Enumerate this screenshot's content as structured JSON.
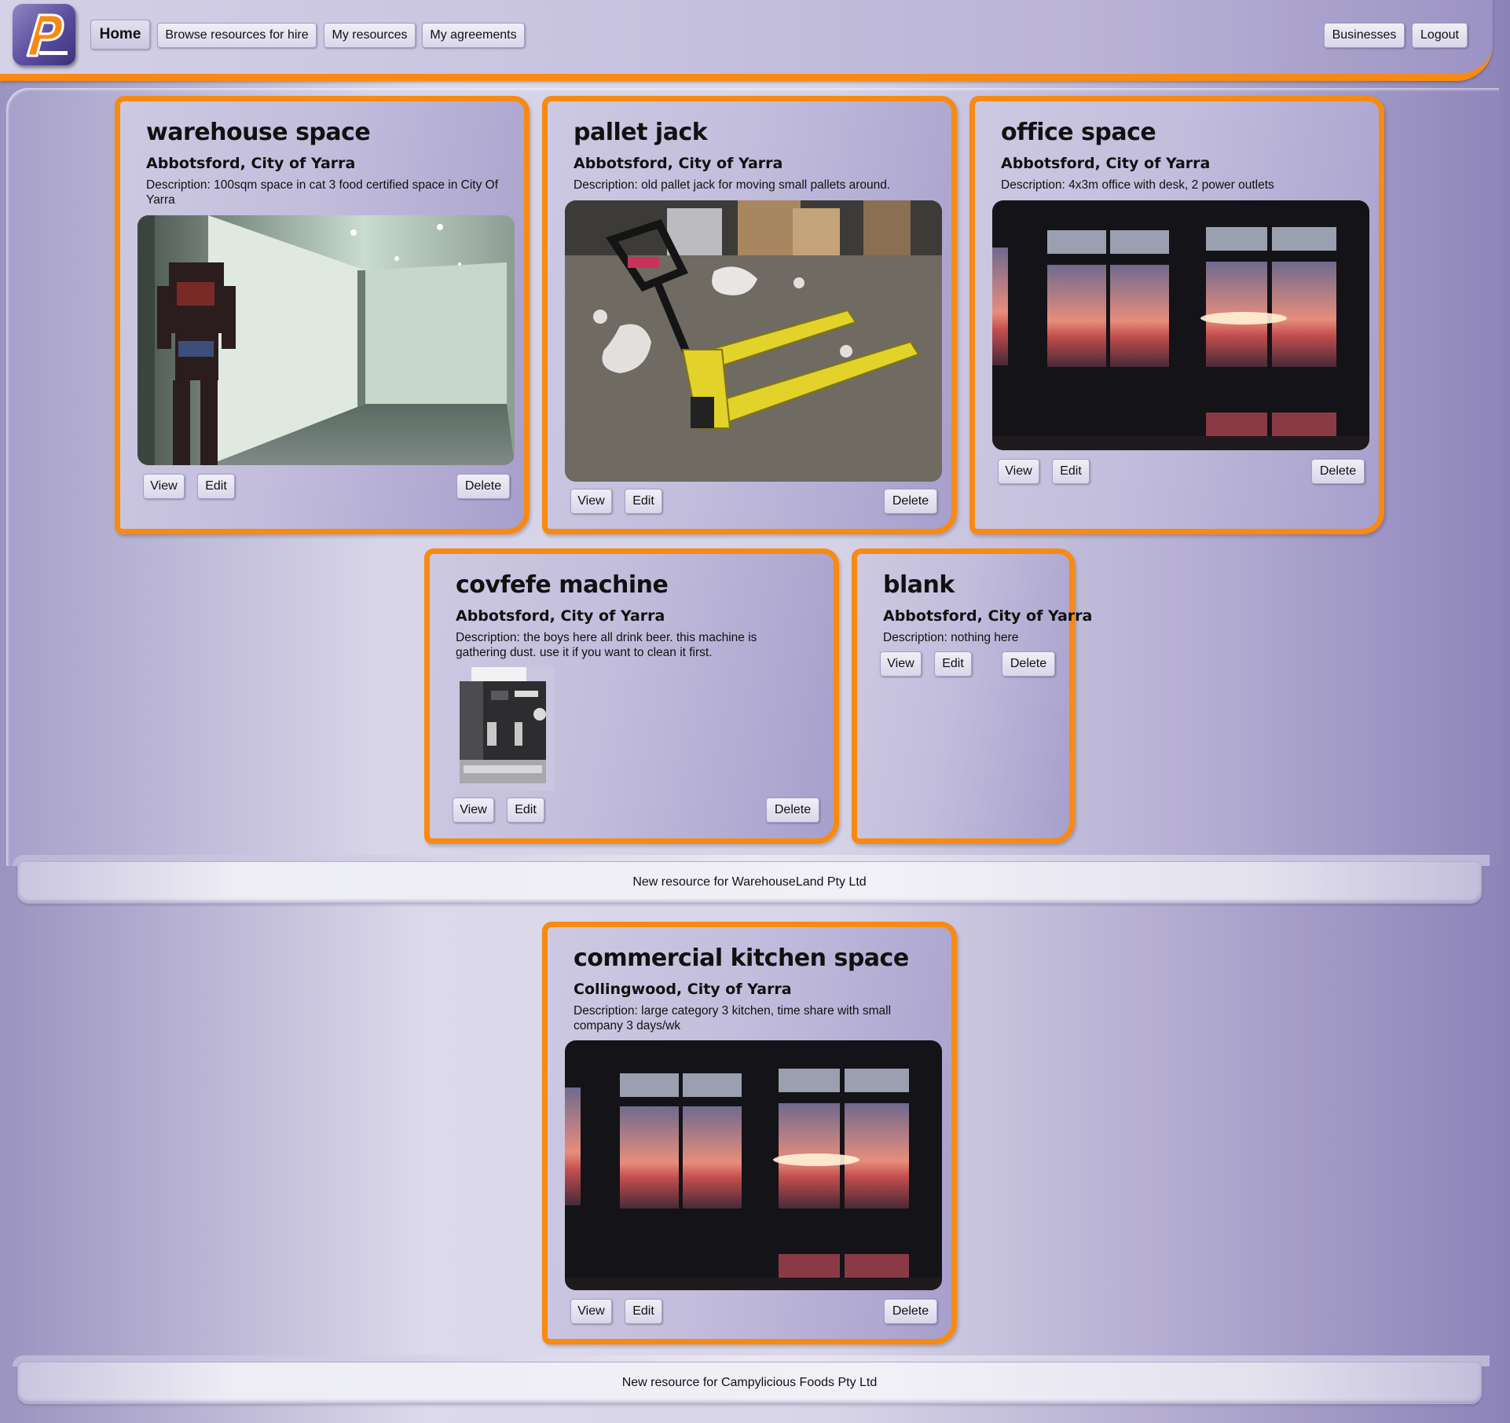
{
  "app": {
    "logo_letter": "P"
  },
  "nav": {
    "home": "Home",
    "browse": "Browse resources for hire",
    "my_resources": "My resources",
    "my_agreements": "My agreements",
    "businesses": "Businesses",
    "logout": "Logout"
  },
  "colors": {
    "accent": "#f88a12",
    "panel": "#c2bddc",
    "logo": "#5b4d9e"
  },
  "buttons": {
    "view": "View",
    "edit": "Edit",
    "delete": "Delete"
  },
  "groups": [
    {
      "resources": [
        {
          "title": "warehouse space",
          "location": "Abbotsford, City of Yarra",
          "description": "Description: 100sqm space in cat 3 food certified space in City Of Yarra",
          "image": "warehouse-interior-photo"
        },
        {
          "title": "pallet jack",
          "location": "Abbotsford, City of Yarra",
          "description": "Description: old pallet jack for moving small pallets around.",
          "image": "yellow-pallet-jack-photo"
        },
        {
          "title": "office space",
          "location": "Abbotsford, City of Yarra",
          "description": "Description: 4x3m office with desk, 2 power outlets",
          "image": "sunset-window-photo"
        },
        {
          "title": "covfefe machine",
          "location": "Abbotsford, City of Yarra",
          "description": "Description: the boys here all drink beer. this machine is gathering dust. use it if you want to clean it first.",
          "image": "espresso-machine-photo"
        },
        {
          "title": "blank",
          "location": "Abbotsford, City of Yarra",
          "description": "Description: nothing here",
          "image": ""
        }
      ],
      "new_resource_label": "New resource for WarehouseLand Pty Ltd"
    },
    {
      "resources": [
        {
          "title": "commercial kitchen space",
          "location": "Collingwood, City of Yarra",
          "description": "Description: large category 3 kitchen, time share with small company 3 days/wk",
          "image": "sunset-window-photo"
        }
      ],
      "new_resource_label": "New resource for Campylicious Foods Pty Ltd"
    }
  ]
}
